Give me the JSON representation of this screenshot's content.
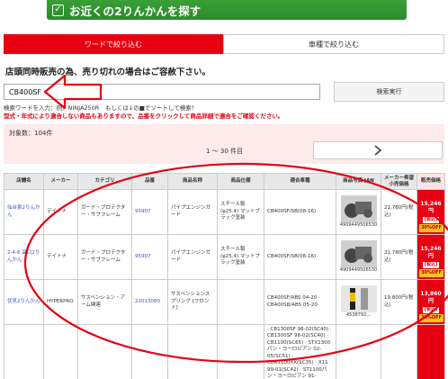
{
  "banner": {
    "title": "お近くの2りんかんを探す"
  },
  "tabs": [
    {
      "label": "ワードで絞り込む"
    },
    {
      "label": "車種で絞り込む"
    }
  ],
  "notice": "店頭同時販売の為、売り切れの場合はご容赦下さい。",
  "search": {
    "value": "CB400SF",
    "button_label": "検索実行"
  },
  "hint": "検索ワードを入力：例）NINJA250R　もしくは↓の■でソートして検索！",
  "warning": "型式・年式により適合しない商品もありますので、品番をクリックして商品詳細で適合をご確認ください。",
  "result": {
    "count_label": "対象数：104件",
    "range_label": "1 ～ 30 件目"
  },
  "table": {
    "headers": [
      "店舗名",
      "メーカー",
      "カテゴリ",
      "品番",
      "商品名称",
      "商品仕様",
      "適合車種",
      "商品写真 JAN",
      "メーカー希望 小売価格",
      "販売価格"
    ],
    "rows": [
      {
        "store": "仙台泉2りんかん",
        "maker": "デイトナ",
        "category": "ガード・プロテクター・サブフレーム",
        "part_no": "95907",
        "name": "パイプエンジンガード",
        "spec": "スチール製(φ25.4) マットブラック塗装",
        "fit": "CB400SF/SB(08-16)",
        "jan": "4909449506530",
        "msrp": "21,780円(税込)",
        "price": "15,246円",
        "tax": "[税込]",
        "off": "30%OFF"
      },
      {
        "store": "2-4-6 高口2りんかん",
        "maker": "デイトナ",
        "category": "ガード・プロテクター・サブフレーム",
        "part_no": "95907",
        "name": "パイプエンジンガード",
        "spec": "スチール製(φ25.4) マットブラック塗装",
        "fit": "CB400SF/SB(08-16)",
        "jan": "4909449506530",
        "msrp": "21,780円(税込)",
        "price": "15,246円",
        "tax": "[税込]",
        "off": "30%OFF"
      },
      {
        "store": "伏見2りんかん",
        "maker": "HYPERPRO",
        "category": "サスペンション・アーム関連",
        "part_no": "22013080",
        "name": "サスペンションスプリング [フロント]",
        "spec": "",
        "fit": "CB400SF/ABS 04-20 · CB400SB/ABS 05-20",
        "jan": "4538792...",
        "msrp": "19,800円(税込)",
        "price": "13,860円",
        "tax": "[税込]",
        "off": "30%OFF"
      },
      {
        "store": "",
        "maker": "",
        "category": "",
        "part_no": "",
        "name": "",
        "spec": "",
        "fit": "· CB1300SF 98-02(SC40) · CB1300SF 98-02(SC40) · CB1100(SC65) · STX1300パン・ヨーロピアン 02-05(SC51) · CBR1100XX(SC35) · X11 99-01(SC42) · ST1100パン・ヨーロピアン 91-01(SC26) · CBR1000RR 04-07(SC57)",
        "jan": "",
        "msrp": "",
        "price": "",
        "tax": "",
        "off": ""
      }
    ]
  },
  "colors": {
    "accent": "#e60012",
    "banner": "#2c8a2c",
    "link": "#3a55c8",
    "badge": "#f7c31e"
  }
}
